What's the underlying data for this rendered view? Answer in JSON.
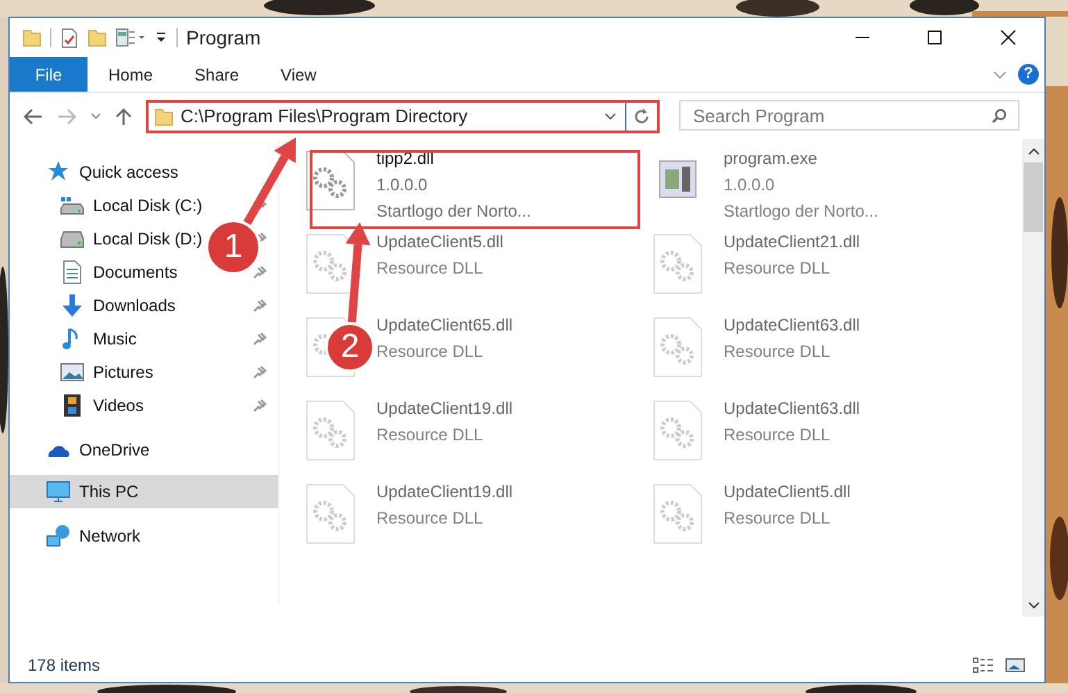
{
  "window": {
    "title": "Program"
  },
  "ribbon": {
    "tabs": [
      {
        "label": "File",
        "kind": "file"
      },
      {
        "label": "Home",
        "kind": "tab"
      },
      {
        "label": "Share",
        "kind": "tab"
      },
      {
        "label": "View",
        "kind": "tab"
      }
    ],
    "help": "?"
  },
  "address_bar": {
    "path": "C:\\Program Files\\Program Directory"
  },
  "search": {
    "placeholder": "Search Program"
  },
  "navigation": [
    {
      "label": "Quick access",
      "selected": false,
      "children": [
        {
          "label": "Local Disk (C:)",
          "pinned": true,
          "selected": false
        },
        {
          "label": "Local Disk (D:)",
          "pinned": true,
          "selected": false
        },
        {
          "label": "Documents",
          "pinned": true,
          "selected": false
        },
        {
          "label": "Downloads",
          "pinned": true,
          "selected": false
        },
        {
          "label": "Music",
          "pinned": true,
          "selected": false
        },
        {
          "label": "Pictures",
          "pinned": true,
          "selected": false
        },
        {
          "label": "Videos",
          "pinned": true,
          "selected": false
        }
      ]
    },
    {
      "label": "OneDrive",
      "selected": false
    },
    {
      "label": "This PC",
      "selected": true
    },
    {
      "label": "Network",
      "selected": false
    }
  ],
  "files": [
    {
      "name": "tipp2.dll",
      "lines": [
        "1.0.0.0",
        "Startlogo der Norto..."
      ],
      "kind": "dll",
      "dimmed": false
    },
    {
      "name": "program.exe",
      "lines": [
        "1.0.0.0",
        "Startlogo der Norto..."
      ],
      "kind": "exe",
      "dimmed": true
    },
    {
      "name": "UpdateClient5.dll",
      "lines": [
        "Resource DLL"
      ],
      "kind": "dll",
      "dimmed": true
    },
    {
      "name": "UpdateClient21.dll",
      "lines": [
        "Resource DLL"
      ],
      "kind": "dll",
      "dimmed": true
    },
    {
      "name": "UpdateClient65.dll",
      "lines": [
        "Resource DLL"
      ],
      "kind": "dll",
      "dimmed": true
    },
    {
      "name": "UpdateClient63.dll",
      "lines": [
        "Resource DLL"
      ],
      "kind": "dll",
      "dimmed": true
    },
    {
      "name": "UpdateClient19.dll",
      "lines": [
        "Resource DLL"
      ],
      "kind": "dll",
      "dimmed": true
    },
    {
      "name": "UpdateClient63.dll",
      "lines": [
        "Resource DLL"
      ],
      "kind": "dll",
      "dimmed": true
    },
    {
      "name": "UpdateClient19.dll",
      "lines": [
        "Resource DLL"
      ],
      "kind": "dll",
      "dimmed": true
    },
    {
      "name": "UpdateClient5.dll",
      "lines": [
        "Resource DLL"
      ],
      "kind": "dll",
      "dimmed": true
    }
  ],
  "status_bar": {
    "text": "178 items"
  },
  "annotations": [
    {
      "label": "1"
    },
    {
      "label": "2"
    }
  ]
}
